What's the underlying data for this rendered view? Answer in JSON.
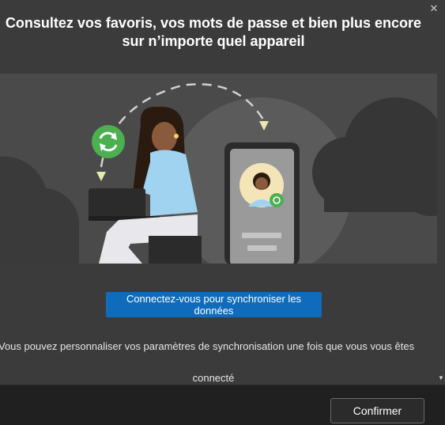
{
  "dialog": {
    "close_glyph": "✕",
    "title_line1": "Consultez vos favoris, vos mots de passe et bien plus encore",
    "title_line2": "sur n’importe quel appareil",
    "cta_label": "Connectez-vous pour synchroniser les données",
    "description_line1": "Vous pouvez personnaliser vos paramètres de synchronisation une fois que vous vous êtes",
    "description_line2": "connecté",
    "scroll_glyph": "▼"
  },
  "footer": {
    "confirm_label": "Confirmer"
  },
  "colors": {
    "background": "#3b3b3b",
    "illustration_bg": "#4a4a4a",
    "accent": "#0f6cbd",
    "sync_green": "#4caf50",
    "skin": "#8a5a3c",
    "hair": "#2b1a10",
    "sweater": "#9fd3f0"
  },
  "icons": {
    "close": "close-icon",
    "sync": "sync-icon",
    "scroll_down": "chevron-down-icon"
  }
}
